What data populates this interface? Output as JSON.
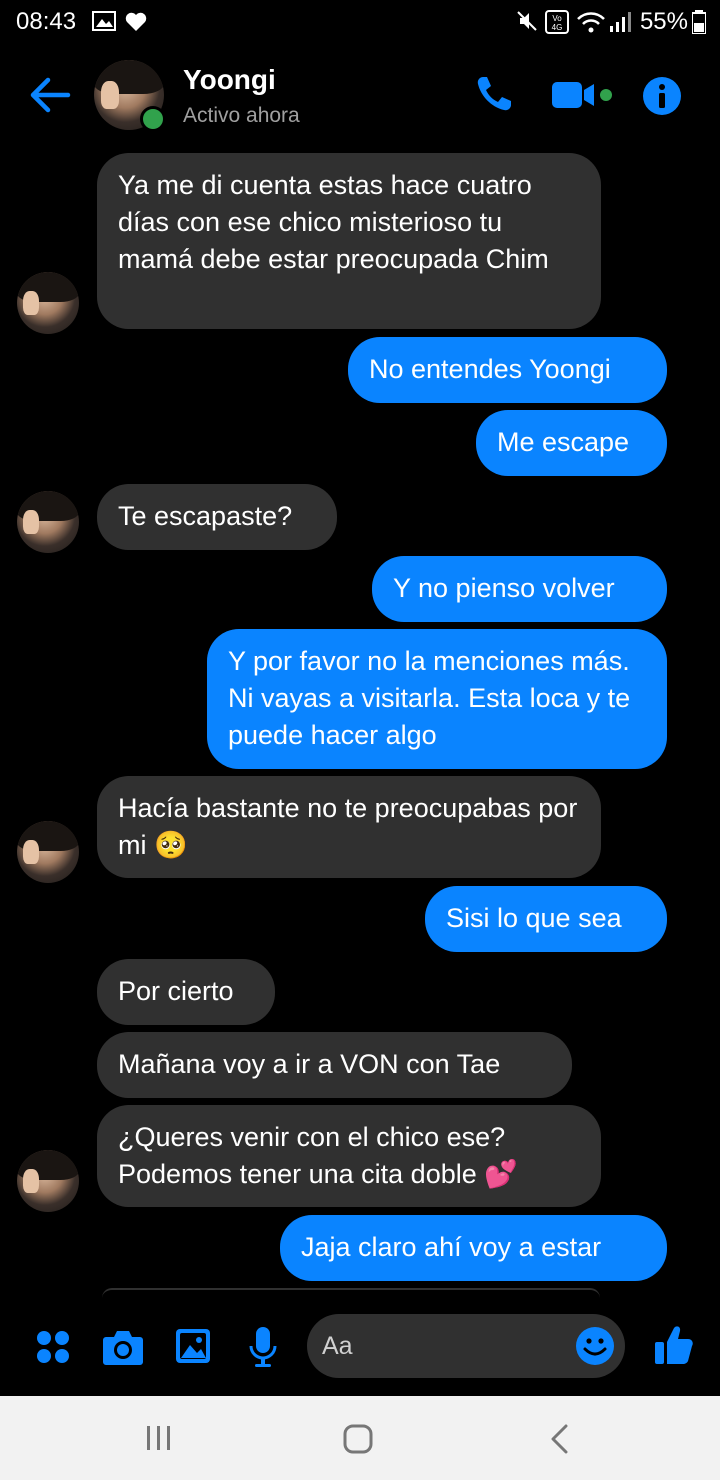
{
  "status_bar": {
    "time": "08:43",
    "battery_pct": "55%",
    "network": "4G"
  },
  "header": {
    "contact_name": "Yoongi",
    "status": "Activo ahora",
    "icons": [
      "back-arrow-icon",
      "phone-icon",
      "video-camera-icon",
      "info-icon"
    ]
  },
  "messages": [
    {
      "dir": "in",
      "text": "Ya me di cuenta estas hace cuatro días con ese chico misterioso tu mamá debe estar preocupada Chim"
    },
    {
      "dir": "out",
      "text": "No entendes Yoongi"
    },
    {
      "dir": "out",
      "text": "Me escape"
    },
    {
      "dir": "in",
      "text": "Te escapaste?"
    },
    {
      "dir": "out",
      "text": "Y no pienso volver"
    },
    {
      "dir": "out",
      "text": "Y por favor no la menciones más. Ni vayas a visitarla. Esta loca y te puede hacer algo"
    },
    {
      "dir": "in",
      "text": "Hacía bastante no te preocupabas por mi 🥺"
    },
    {
      "dir": "out",
      "text": "Sisi lo que sea"
    },
    {
      "dir": "in",
      "text": "Por cierto"
    },
    {
      "dir": "in",
      "text": "Mañana voy a ir a VON con Tae"
    },
    {
      "dir": "in",
      "text": "¿Queres venir con el chico ese? Podemos tener una cita doble 💕"
    },
    {
      "dir": "out",
      "text": "Jaja claro ahí voy a estar"
    }
  ],
  "composer": {
    "placeholder": "Aa",
    "icons": [
      "menu-dots-icon",
      "camera-icon",
      "gallery-icon",
      "microphone-icon",
      "emoji-icon",
      "like-thumb-icon"
    ]
  },
  "colors": {
    "accent": "#0a84ff",
    "incoming_bubble": "#303030",
    "online": "#31a24c",
    "background": "#000000"
  }
}
